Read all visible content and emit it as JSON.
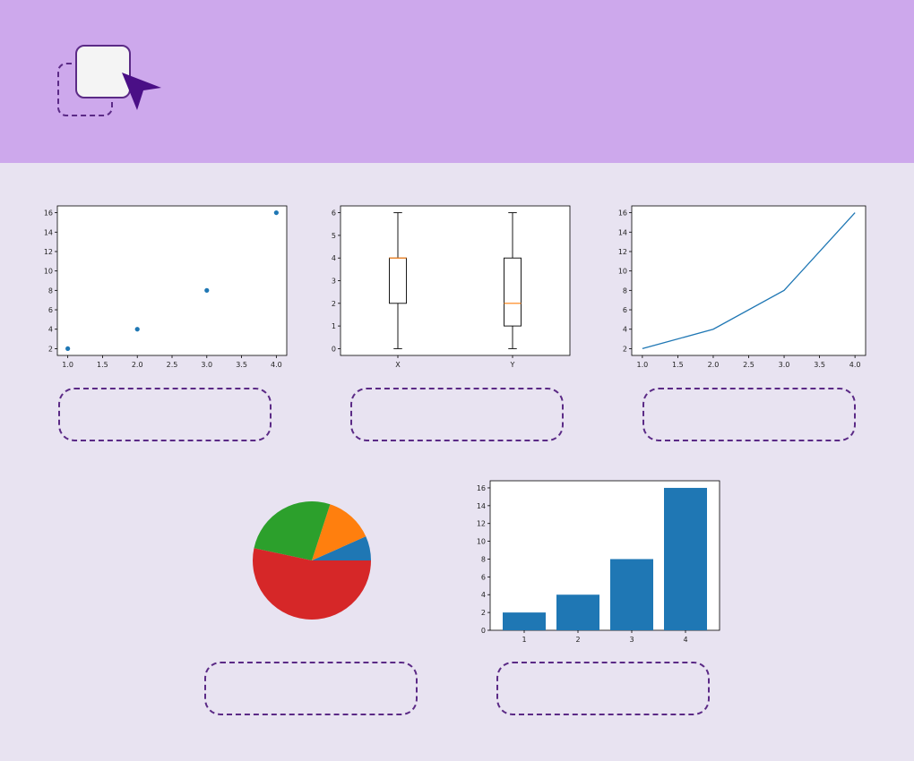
{
  "colors": {
    "header_bg": "#cda8ec",
    "page_bg": "#e8e3f1",
    "accent": "#5b2a86",
    "series_blue": "#1f77b4",
    "median_orange": "#ff7f0e"
  },
  "icons": {
    "drag_tile": "rounded-square",
    "cursor": "arrow-pointer-icon"
  },
  "chart_data": [
    {
      "type": "scatter",
      "x": [
        1,
        2,
        3,
        4
      ],
      "y": [
        2,
        4,
        8,
        16
      ],
      "xticks": [
        "1.0",
        "1.5",
        "2.0",
        "2.5",
        "3.0",
        "3.5",
        "4.0"
      ],
      "yticks": [
        "2",
        "4",
        "6",
        "8",
        "10",
        "12",
        "14",
        "16"
      ],
      "xlim": [
        0.85,
        4.15
      ],
      "ylim": [
        1.3,
        16.7
      ],
      "grid": false
    },
    {
      "type": "box",
      "categories": [
        "X",
        "Y"
      ],
      "boxes": [
        {
          "whislo": 0,
          "q1": 2,
          "med": 4,
          "q3": 4,
          "whishi": 6
        },
        {
          "whislo": 0,
          "q1": 1,
          "med": 2,
          "q3": 4,
          "whishi": 6
        }
      ],
      "yticks": [
        "0",
        "1",
        "2",
        "3",
        "4",
        "5",
        "6"
      ],
      "ylim": [
        -0.3,
        6.3
      ],
      "grid": false
    },
    {
      "type": "line",
      "x": [
        1,
        2,
        3,
        4
      ],
      "y": [
        2,
        4,
        8,
        16
      ],
      "xticks": [
        "1.0",
        "1.5",
        "2.0",
        "2.5",
        "3.0",
        "3.5",
        "4.0"
      ],
      "yticks": [
        "2",
        "4",
        "6",
        "8",
        "10",
        "12",
        "14",
        "16"
      ],
      "xlim": [
        0.85,
        4.15
      ],
      "ylim": [
        1.3,
        16.7
      ],
      "grid": false
    },
    {
      "type": "pie",
      "values": [
        2,
        4,
        8,
        16
      ],
      "colors": [
        "#1f77b4",
        "#ff7f0e",
        "#2ca02c",
        "#d62728"
      ]
    },
    {
      "type": "bar",
      "categories": [
        "1",
        "2",
        "3",
        "4"
      ],
      "values": [
        2,
        4,
        8,
        16
      ],
      "yticks": [
        "0",
        "2",
        "4",
        "6",
        "8",
        "10",
        "12",
        "14",
        "16"
      ],
      "ylim": [
        0,
        16.8
      ],
      "grid": false
    }
  ]
}
